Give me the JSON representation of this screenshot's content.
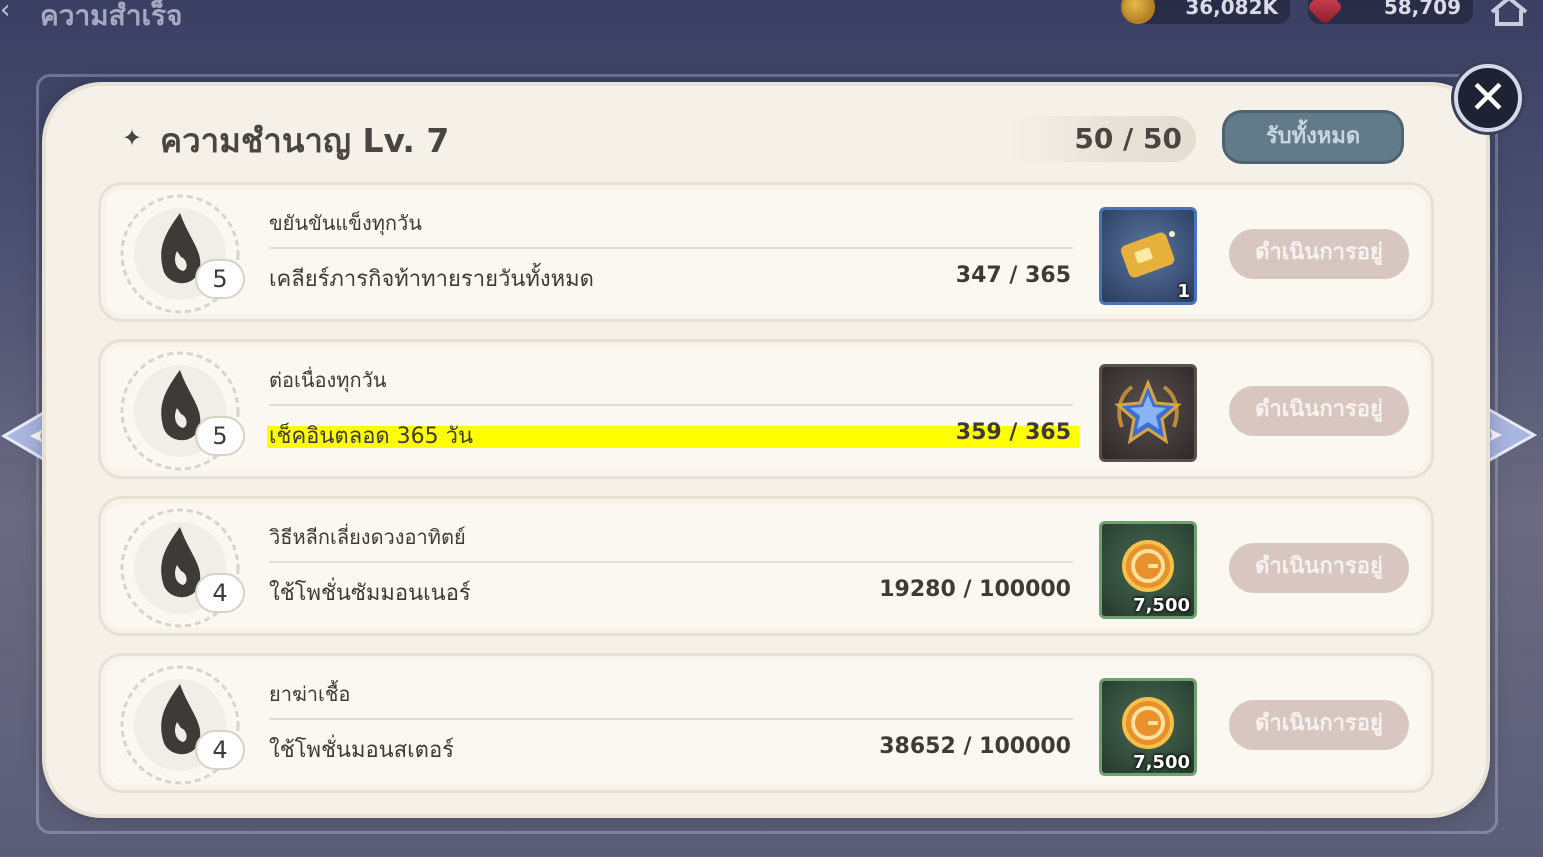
{
  "screen": {
    "title": "ความสำเร็จ"
  },
  "currencies": [
    {
      "icon": "gold-coin-icon",
      "value": "36,082K"
    },
    {
      "icon": "red-gem-icon",
      "value": "58,709"
    }
  ],
  "panel": {
    "header": "ความชำนาญ Lv. 7",
    "progress": "50 / 50",
    "claim_all_label": "รับทั้งหมด"
  },
  "achievements": [
    {
      "title": "ขยันขันแข็งทุกวัน",
      "description": "เคลียร์ภารกิจท้าทายรายวันทั้งหมด",
      "progress": "347 / 365",
      "level": "5",
      "reward": {
        "icon": "golden-scroll-icon",
        "qty": "1"
      },
      "status": "ดำเนินการอยู่"
    },
    {
      "title": "ต่อเนื่องทุกวัน",
      "description": "เช็คอินตลอด 365 วัน",
      "progress": "359 / 365",
      "level": "5",
      "reward": {
        "icon": "blue-star-medal-icon",
        "qty": ""
      },
      "status": "ดำเนินการอยู่"
    },
    {
      "title": "วิธีหลีกเลี่ยงดวงอาทิตย์",
      "description": "ใช้โพชั่นซัมมอนเนอร์",
      "progress": "19280 / 100000",
      "level": "4",
      "reward": {
        "icon": "gold-coin-icon",
        "qty": "7,500"
      },
      "status": "ดำเนินการอยู่"
    },
    {
      "title": "ยาฆ่าเชื้อ",
      "description": "ใช้โพชั่นมอนสเตอร์",
      "progress": "38652 / 100000",
      "level": "4",
      "reward": {
        "icon": "gold-coin-icon",
        "qty": "7,500"
      },
      "status": "ดำเนินการอยู่"
    }
  ],
  "colors": {
    "panel_bg": "#f6f1e8",
    "claim_button": "#627a8a",
    "status_button": "#d8c7c1",
    "highlight": "#ffff00"
  }
}
